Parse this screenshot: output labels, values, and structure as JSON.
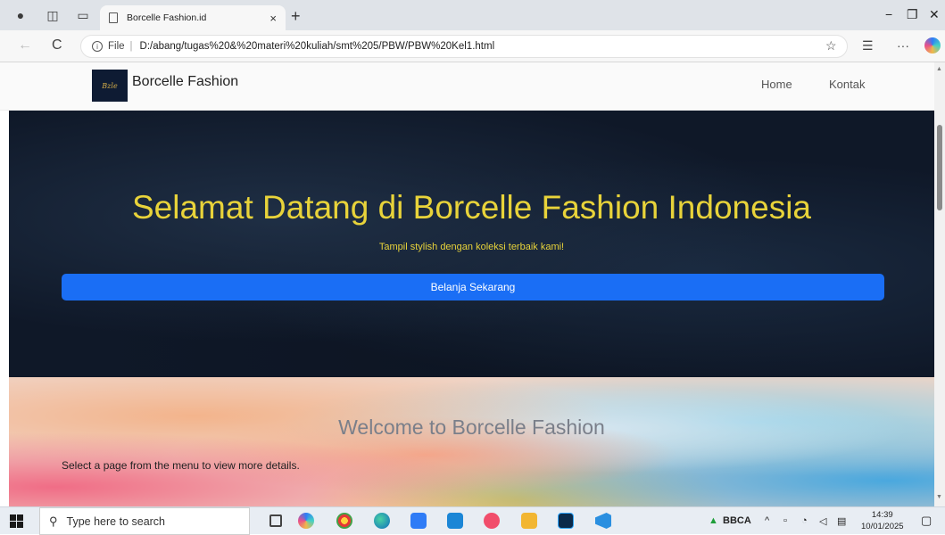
{
  "browser": {
    "tab_title": "Borcelle Fashion.id",
    "tab_close": "×",
    "new_tab": "+",
    "url_label": "File",
    "url": "D:/abang/tugas%20&%20materi%20kuliah/smt%205/PBW/PBW%20Kel1.html",
    "back_icon": "←",
    "refresh_icon": "C",
    "more_icon": "···",
    "minimize_icon": "−",
    "restore_icon": "❐",
    "close_icon": "✕"
  },
  "site": {
    "brand": "Borcelle Fashion",
    "logo_text": "Bzle",
    "nav": [
      {
        "label": "Home"
      },
      {
        "label": "Kontak"
      }
    ]
  },
  "hero": {
    "title": "Selamat Datang di Borcelle Fashion Indonesia",
    "subtitle": "Tampil stylish dengan koleksi terbaik kami!",
    "cta": "Belanja Sekarang"
  },
  "welcome": {
    "title": "Welcome to Borcelle Fashion",
    "text": "Select a page from the menu to view more details."
  },
  "taskbar": {
    "search_placeholder": "Type here to search",
    "stock_ticker": "BBCA",
    "time": "14:39",
    "date": "10/01/2025",
    "accent_color": "#1a6ef5"
  }
}
